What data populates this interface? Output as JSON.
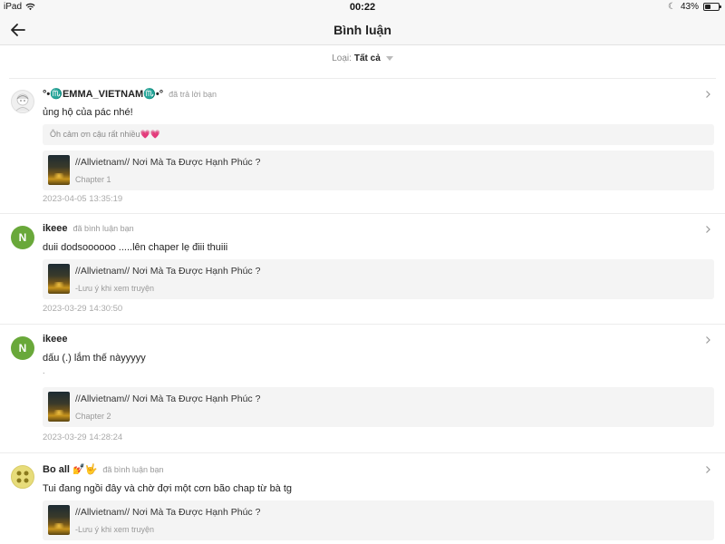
{
  "status_bar": {
    "device": "iPad",
    "time": "00:22",
    "battery": "43%",
    "battery_level": 0.43
  },
  "nav": {
    "title": "Bình luận",
    "back_icon": "arrow-left-icon"
  },
  "filter": {
    "label": "Loại:",
    "value": "Tất cả"
  },
  "comments": [
    {
      "username": "°•♏EMMA_VIETNAM♏•°",
      "action": "đã trả lời bạn",
      "text": "ủng hộ của pác nhé!",
      "quote": "Ôh cảm ơn cậu rất nhiều💗💗",
      "story_title": "//Allvietnam// Nơi Mà Ta Được Hạnh Phúc ?",
      "story_sub": "Chapter 1",
      "time": "2023-04-05 13:35:19"
    },
    {
      "avatar_letter": "N",
      "username": "ikeee",
      "action": "đã bình luận bạn",
      "text": "duii dodsoooooo .....lên chaper lẹ điii thuiii",
      "story_title": "//Allvietnam// Nơi Mà Ta Được Hạnh Phúc ?",
      "story_sub": "-Lưu ý khi xem truyện",
      "time": "2023-03-29 14:30:50"
    },
    {
      "avatar_letter": "N",
      "username": "ikeee",
      "action": "",
      "text": "dấu (.) lắm thế nàyyyyy",
      "text2": ".",
      "story_title": "//Allvietnam// Nơi Mà Ta Được Hạnh Phúc ?",
      "story_sub": "Chapter 2",
      "time": "2023-03-29 14:28:24"
    },
    {
      "username": "Bo all 💅🤟",
      "action": "đã bình luận bạn",
      "text": "Tui đang ngồi đây và chờ đợi một cơn bão chap từ bà tg",
      "story_title": "//Allvietnam// Nơi Mà Ta Được Hạnh Phúc ?",
      "story_sub": "-Lưu ý khi xem truyện"
    }
  ]
}
